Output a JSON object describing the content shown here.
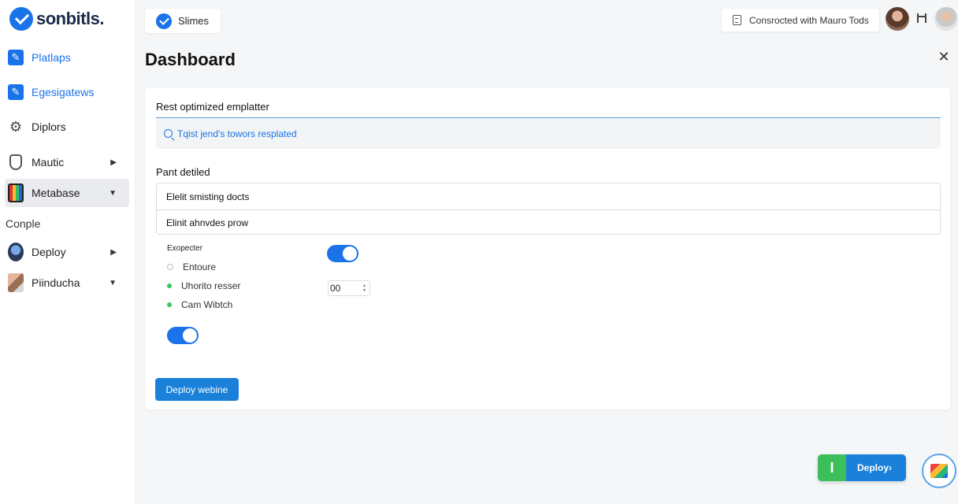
{
  "app": {
    "logo_text": "sonbitls."
  },
  "sidebar": {
    "items": [
      {
        "label": "Platlaps",
        "icon": "edit-square-icon"
      },
      {
        "label": "Egesigatews",
        "icon": "edit-square-icon"
      },
      {
        "label": "Diplors",
        "icon": "gear-icon"
      },
      {
        "label": "Mautic",
        "icon": "shield-icon"
      },
      {
        "label": "Metabase",
        "icon": "metabase-grid-icon"
      },
      {
        "label": "Deploy",
        "icon": "globe-icon"
      },
      {
        "label": "Piinducha",
        "icon": "photo-icon"
      }
    ],
    "section_label": "Conple"
  },
  "topbar": {
    "tab_label": "Slimes",
    "connection_text": "Consrocted with Mauro Tods"
  },
  "page": {
    "title": "Dashboard"
  },
  "card": {
    "section1_title": "Rest optimized emplatter",
    "search_placeholder": "Tqist jend's towors resplated",
    "section2_title": "Pant detiled",
    "list_rows": [
      "Elelit smisting docts",
      "Elinit ahnvdes prow"
    ],
    "options_label": "Exopecter",
    "options": [
      "Entoure",
      "Uhorito resser",
      "Cam Wibtch"
    ],
    "stepper_value": "00",
    "primary_button": "Deploy webine"
  },
  "floating": {
    "deploy_label": "Deploy",
    "deploy_arrow": "›"
  },
  "colors": {
    "accent": "#1a73e8",
    "button": "#1a80d9",
    "green": "#3cbf5a"
  }
}
